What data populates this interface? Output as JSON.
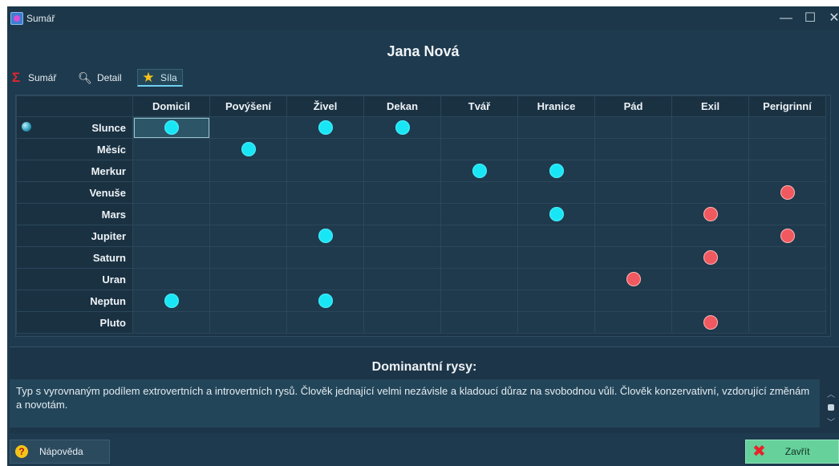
{
  "window": {
    "title": "Sumář",
    "controls": [
      "—",
      "☐",
      "✕"
    ]
  },
  "header": {
    "person_name": "Jana Nová"
  },
  "tabs": [
    {
      "label": "Sumář",
      "icon": "sigma-icon",
      "active": false
    },
    {
      "label": "Detail",
      "icon": "magnifier-icon",
      "active": false
    },
    {
      "label": "Síla",
      "icon": "star-icon",
      "active": true
    }
  ],
  "grid": {
    "columns": [
      "Domicil",
      "Povýšení",
      "Živel",
      "Dekan",
      "Tvář",
      "Hranice",
      "Pád",
      "Exil",
      "Perigrinní"
    ],
    "rows": [
      {
        "planet": "Slunce",
        "cells": [
          "cyan",
          "",
          "cyan",
          "cyan",
          "",
          "",
          "",
          "",
          ""
        ]
      },
      {
        "planet": "Měsíc",
        "cells": [
          "",
          "cyan",
          "",
          "",
          "",
          "",
          "",
          "",
          ""
        ]
      },
      {
        "planet": "Merkur",
        "cells": [
          "",
          "",
          "",
          "",
          "cyan",
          "cyan",
          "",
          "",
          ""
        ]
      },
      {
        "planet": "Venuše",
        "cells": [
          "",
          "",
          "",
          "",
          "",
          "",
          "",
          "",
          "red"
        ]
      },
      {
        "planet": "Mars",
        "cells": [
          "",
          "",
          "",
          "",
          "",
          "cyan",
          "",
          "red",
          ""
        ]
      },
      {
        "planet": "Jupiter",
        "cells": [
          "",
          "",
          "cyan",
          "",
          "",
          "",
          "",
          "",
          "red"
        ]
      },
      {
        "planet": "Saturn",
        "cells": [
          "",
          "",
          "",
          "",
          "",
          "",
          "",
          "red",
          ""
        ]
      },
      {
        "planet": "Uran",
        "cells": [
          "",
          "",
          "",
          "",
          "",
          "",
          "red",
          "",
          ""
        ]
      },
      {
        "planet": "Neptun",
        "cells": [
          "cyan",
          "",
          "cyan",
          "",
          "",
          "",
          "",
          "",
          ""
        ]
      },
      {
        "planet": "Pluto",
        "cells": [
          "",
          "",
          "",
          "",
          "",
          "",
          "",
          "red",
          ""
        ]
      }
    ],
    "colors": {
      "cyan": "#19e6f5",
      "red": "#f0595f"
    }
  },
  "dominant": {
    "heading": "Dominantní rysy:",
    "text": "Typ s vyrovnaným podílem extrovertních a introvertních rysů. Člověk jednající velmi nezávisle a kladoucí důraz na svobodnou vůli. Člověk konzervativní, vzdorující změnám a novotám."
  },
  "footer": {
    "help_label": "Nápověda",
    "close_label": "Zavřít"
  }
}
